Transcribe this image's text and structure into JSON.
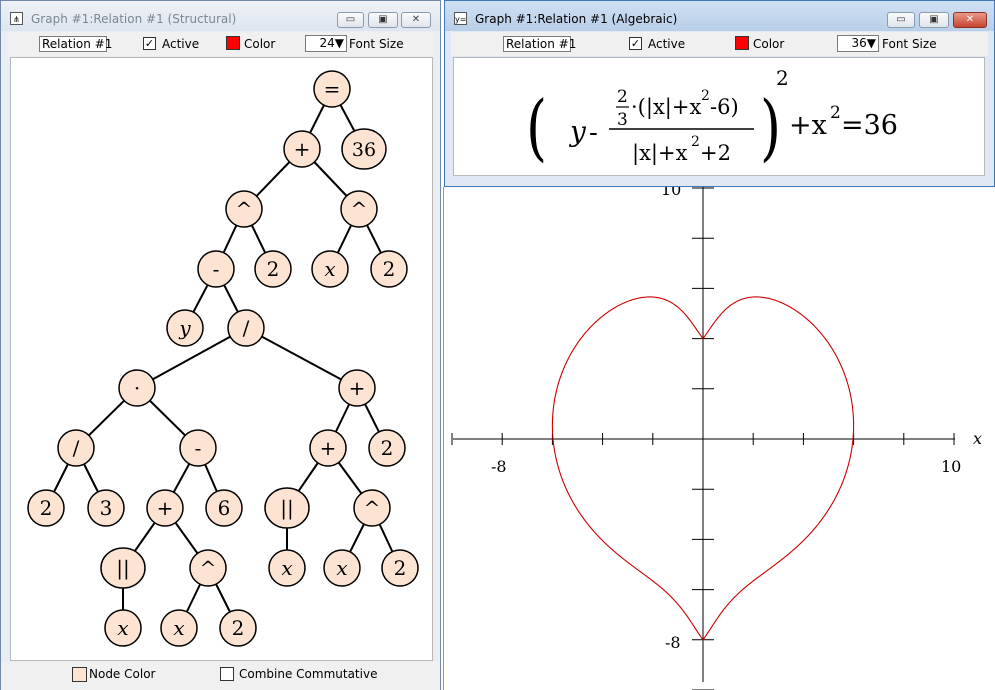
{
  "structural_window": {
    "title": "Graph #1:Relation #1 (Structural)",
    "relation_name": "Relation #1",
    "active_label": "Active",
    "active_checked": true,
    "color_label": "Color",
    "color": "#ff0000",
    "font_size": "24",
    "font_size_label": "Font Size",
    "node_color_label": "Node Color",
    "node_color": "#fde4d2",
    "combine_commutative_label": "Combine Commutative",
    "combine_commutative_checked": false,
    "tree_nodes": [
      {
        "id": "eq",
        "label": "=",
        "italic": false,
        "children": [
          "plus1",
          "n36"
        ]
      },
      {
        "id": "plus1",
        "label": "+",
        "italic": false,
        "children": [
          "pow1",
          "pow2"
        ]
      },
      {
        "id": "n36",
        "label": "36",
        "italic": false,
        "children": []
      },
      {
        "id": "pow1",
        "label": "^",
        "italic": false,
        "children": [
          "minus1",
          "two1"
        ]
      },
      {
        "id": "pow2",
        "label": "^",
        "italic": false,
        "children": [
          "x1",
          "two2"
        ]
      },
      {
        "id": "minus1",
        "label": "-",
        "italic": false,
        "children": [
          "y",
          "div1"
        ]
      },
      {
        "id": "two1",
        "label": "2",
        "italic": false,
        "children": []
      },
      {
        "id": "x1",
        "label": "x",
        "italic": true,
        "children": []
      },
      {
        "id": "two2",
        "label": "2",
        "italic": false,
        "children": []
      },
      {
        "id": "y",
        "label": "y",
        "italic": true,
        "children": []
      },
      {
        "id": "div1",
        "label": "/",
        "italic": false,
        "children": [
          "dot",
          "plus2"
        ]
      },
      {
        "id": "dot",
        "label": "·",
        "italic": false,
        "children": [
          "div2",
          "minus2"
        ]
      },
      {
        "id": "plus2",
        "label": "+",
        "italic": false,
        "children": [
          "plus3",
          "two3"
        ]
      },
      {
        "id": "div2",
        "label": "/",
        "italic": false,
        "children": [
          "two4",
          "three"
        ]
      },
      {
        "id": "minus2",
        "label": "-",
        "italic": false,
        "children": [
          "plus4",
          "six"
        ]
      },
      {
        "id": "plus3",
        "label": "+",
        "italic": false,
        "children": [
          "abs1",
          "pow3"
        ]
      },
      {
        "id": "two3",
        "label": "2",
        "italic": false,
        "children": []
      },
      {
        "id": "two4",
        "label": "2",
        "italic": false,
        "children": []
      },
      {
        "id": "three",
        "label": "3",
        "italic": false,
        "children": []
      },
      {
        "id": "plus4",
        "label": "+",
        "italic": false,
        "children": [
          "abs2",
          "pow4"
        ]
      },
      {
        "id": "six",
        "label": "6",
        "italic": false,
        "children": []
      },
      {
        "id": "abs1",
        "label": "||",
        "italic": false,
        "children": [
          "x2"
        ]
      },
      {
        "id": "pow3",
        "label": "^",
        "italic": false,
        "children": [
          "x3",
          "two5"
        ]
      },
      {
        "id": "abs2",
        "label": "||",
        "italic": false,
        "children": [
          "x4"
        ]
      },
      {
        "id": "pow4",
        "label": "^",
        "italic": false,
        "children": [
          "x5",
          "two6"
        ]
      },
      {
        "id": "x2",
        "label": "x",
        "italic": true,
        "children": []
      },
      {
        "id": "x3",
        "label": "x",
        "italic": true,
        "children": []
      },
      {
        "id": "two5",
        "label": "2",
        "italic": false,
        "children": []
      },
      {
        "id": "x4",
        "label": "x",
        "italic": true,
        "children": []
      },
      {
        "id": "x5",
        "label": "x",
        "italic": true,
        "children": []
      },
      {
        "id": "two6",
        "label": "2",
        "italic": false,
        "children": []
      }
    ]
  },
  "algebraic_window": {
    "title": "Graph #1:Relation #1 (Algebraic)",
    "relation_name": "Relation #1",
    "active_label": "Active",
    "active_checked": true,
    "color_label": "Color",
    "color": "#ff0000",
    "font_size": "36",
    "font_size_label": "Font Size",
    "formula": {
      "open_paren": "(",
      "y": "y",
      "minus": "-",
      "two": "2",
      "three": "3",
      "numerator_rest": "·(|x|+x",
      "numerator_exp": "2",
      "numerator_tail": "-6)",
      "denominator_base": "|x|+x",
      "denominator_exp": "2",
      "denominator_tail": "+2",
      "close_paren": ")",
      "outer_exp": "2",
      "plus_x": "+x",
      "x_exp": "2",
      "equals_rhs": "=36"
    }
  },
  "graph": {
    "x_axis_label": "x",
    "x_min_label": "-8",
    "x_max_label": "10",
    "y_max_label": "10",
    "y_min_label": "-8",
    "curve_color": "#cc0000",
    "equation": "(y - (2/3)(|x| + x^2 - 6)/(|x| + x^2 + 2))^2 + x^2 = 36"
  },
  "chart_data": {
    "type": "line",
    "title": "",
    "xlabel": "x",
    "ylabel": "",
    "tick_labels_x": [
      "-8",
      "10"
    ],
    "tick_labels_y": [
      "10",
      "-8"
    ],
    "xlim": [
      -10,
      10
    ],
    "ylim": [
      -10,
      10
    ],
    "tick_step": 2,
    "grid": false,
    "series": [
      {
        "color": "#cc0000",
        "equation": "(y - (2/3)(|x| + x^2 - 6)/(|x| + x^2 + 2))^2 + x^2 = 36",
        "points_upper": [
          [
            -6,
            0.67
          ],
          [
            -5.5,
            3.1
          ],
          [
            -5,
            4.0
          ],
          [
            -4,
            5.1
          ],
          [
            -3,
            5.5
          ],
          [
            -2,
            5.3
          ],
          [
            -1,
            4.8
          ],
          [
            0,
            4
          ],
          [
            1,
            4.8
          ],
          [
            2,
            5.3
          ],
          [
            3,
            5.5
          ],
          [
            4,
            5.1
          ],
          [
            5,
            4.0
          ],
          [
            5.5,
            3.1
          ],
          [
            6,
            0.67
          ]
        ],
        "points_lower": [
          [
            -6,
            0.67
          ],
          [
            -5.5,
            -1.8
          ],
          [
            -5,
            -2.7
          ],
          [
            -4,
            -3.8
          ],
          [
            -3,
            -4.8
          ],
          [
            -2,
            -5.9
          ],
          [
            -1,
            -6.3
          ],
          [
            0,
            -8
          ],
          [
            1,
            -6.3
          ],
          [
            2,
            -5.9
          ],
          [
            3,
            -4.8
          ],
          [
            4,
            -3.8
          ],
          [
            5,
            -2.7
          ],
          [
            5.5,
            -1.8
          ],
          [
            6,
            0.67
          ]
        ]
      }
    ]
  }
}
